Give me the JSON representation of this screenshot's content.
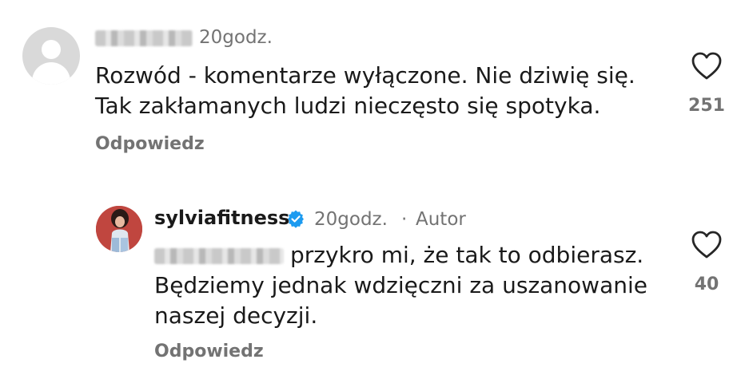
{
  "comment": {
    "time": "20godz.",
    "text_line1": "Rozwód - komentarze wyłączone. Nie dziwię się.",
    "text_line2": "Tak zakłamanych ludzi nieczęsto się spotyka.",
    "likes": "251",
    "reply_label": "Odpowiedz"
  },
  "reply": {
    "username": "sylviafitness",
    "time": "20godz.",
    "separator": "·",
    "author_badge": "Autor",
    "text_line1": "przykro mi, że tak to odbierasz.",
    "text_line2": "Będziemy jednak wdzięczni za uszanowanie",
    "text_line3": "naszej decyzji.",
    "likes": "40",
    "reply_label": "Odpowiedz"
  },
  "icons": {
    "default_avatar": "default-avatar-icon",
    "heart": "heart-outline-icon",
    "verified": "verified-badge-icon"
  },
  "colors": {
    "text": "#1a1a1a",
    "muted": "#737373",
    "verified_blue": "#1d9bf0"
  }
}
